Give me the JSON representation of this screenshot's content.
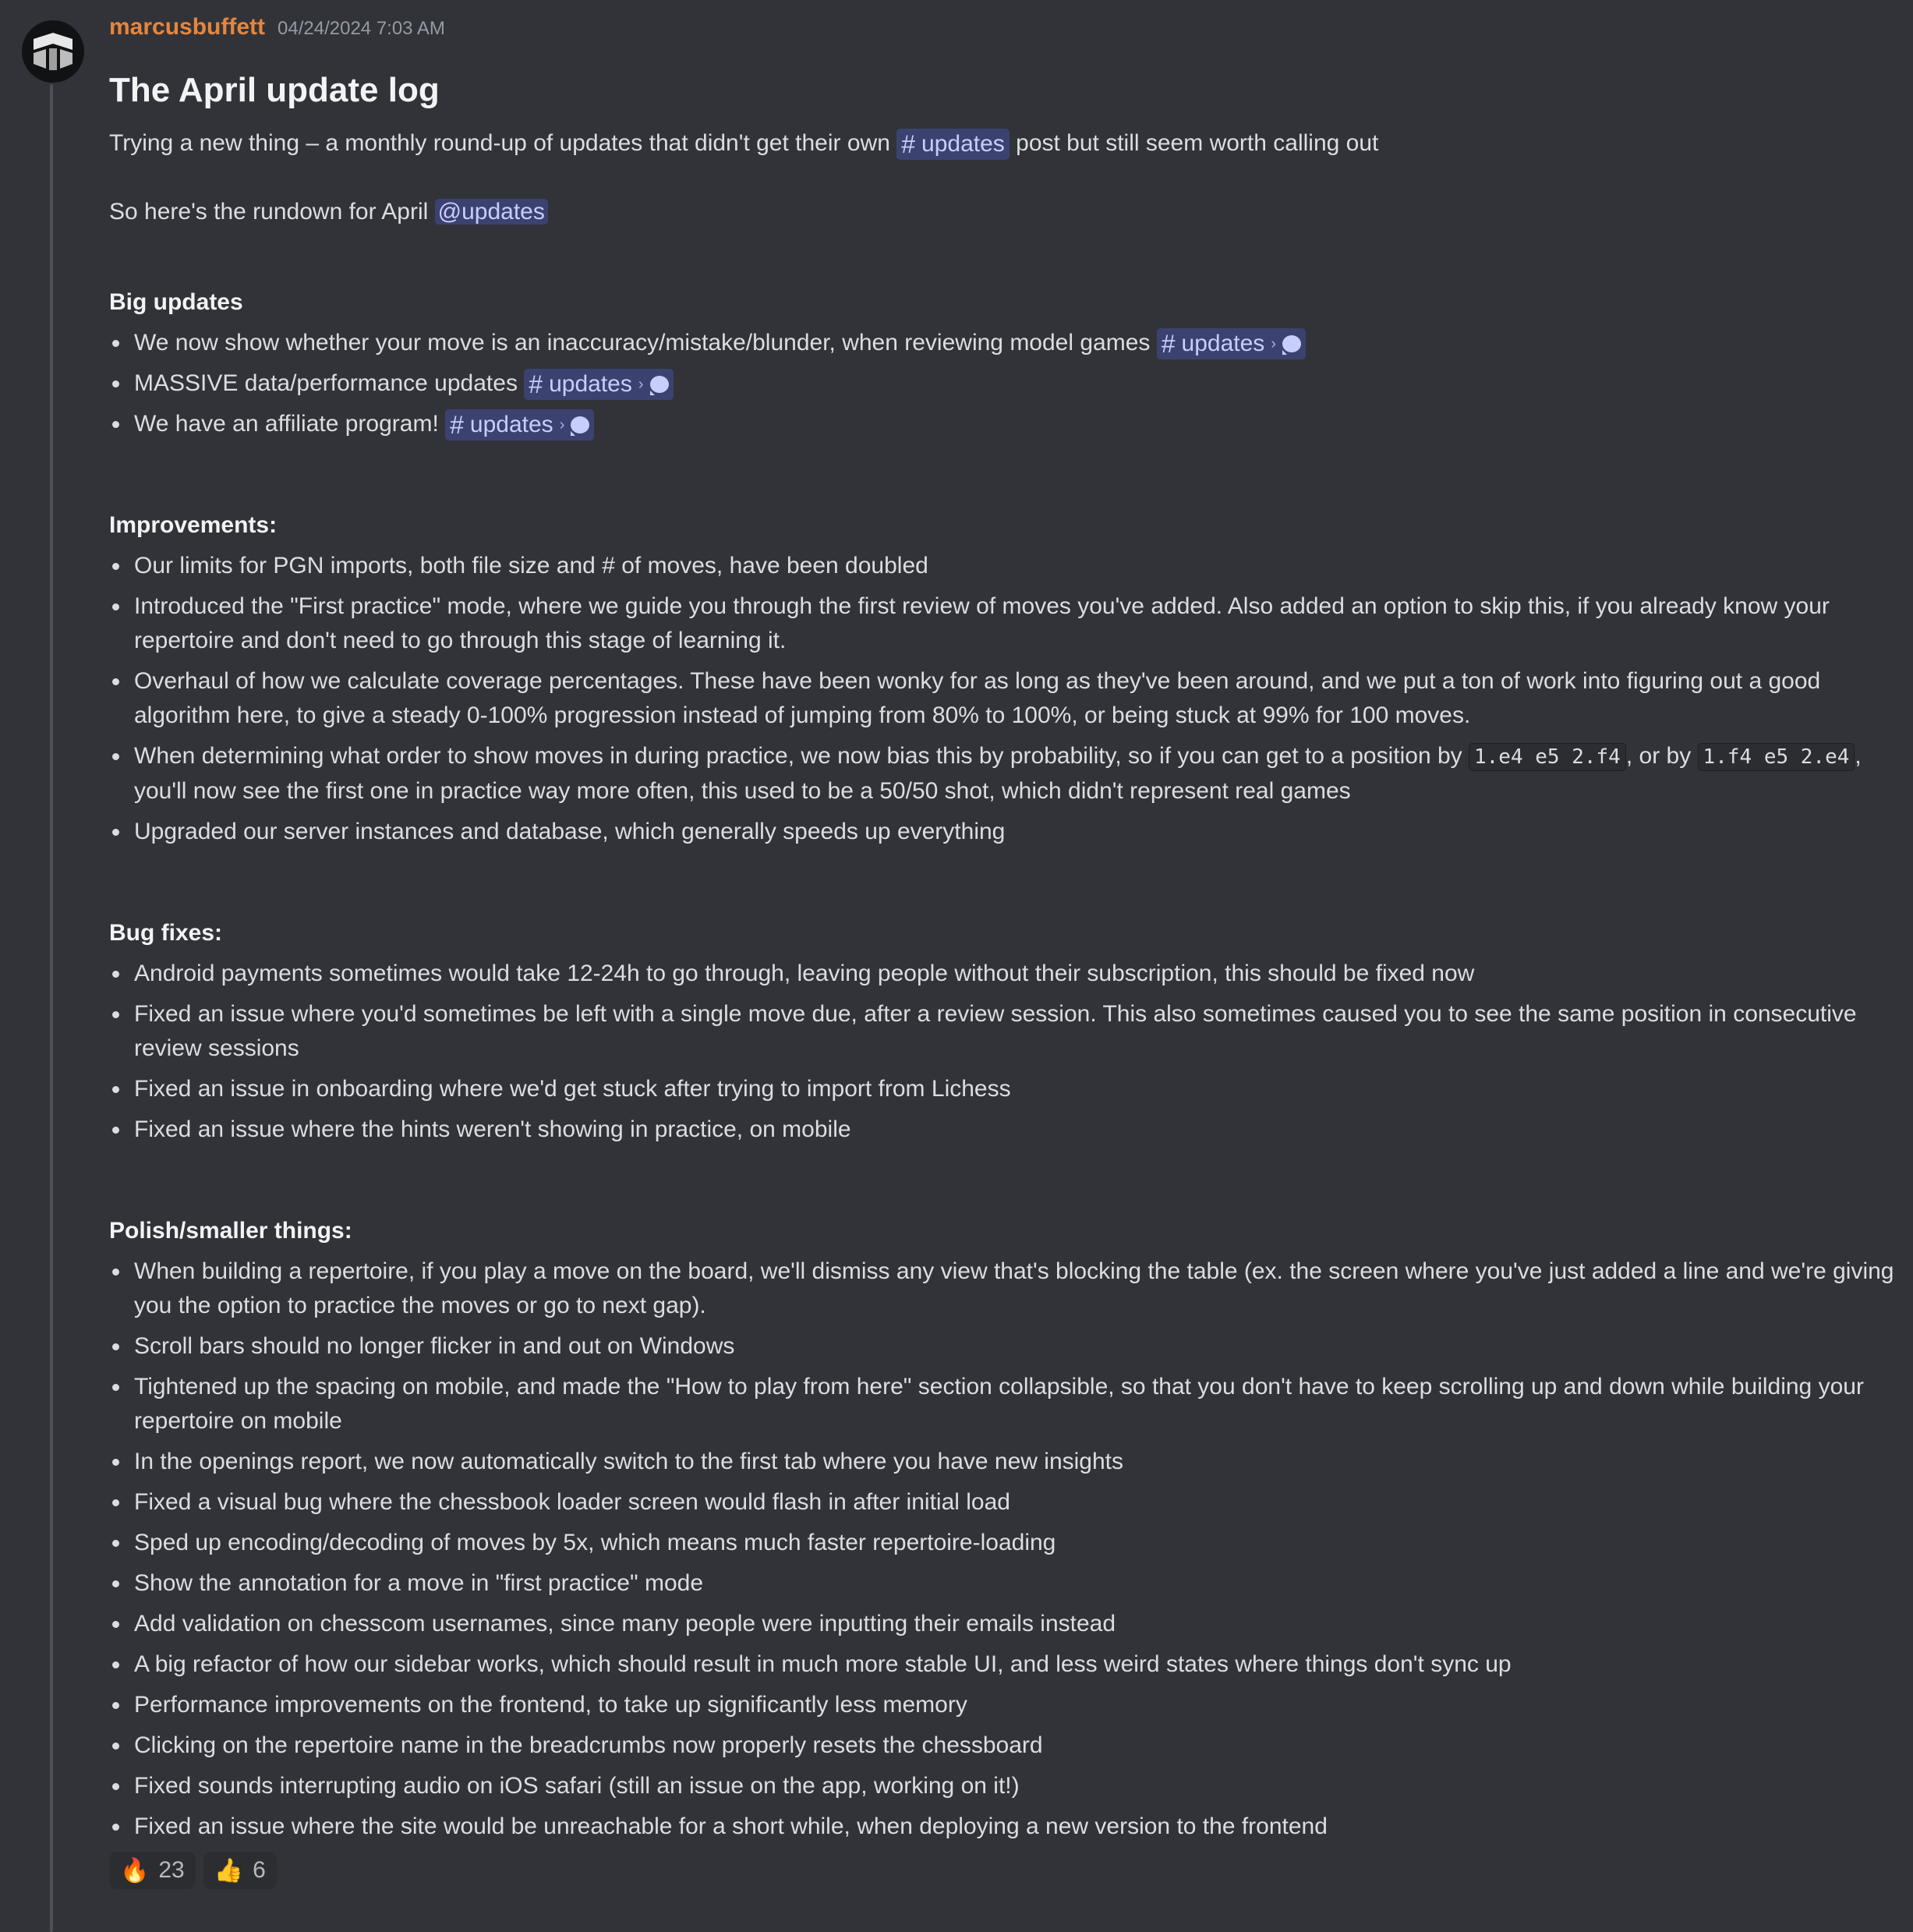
{
  "message": {
    "username": "marcusbuffett",
    "timestamp": "04/24/2024 7:03 AM",
    "title": "The April update log",
    "intro_before": "Trying a new thing – a monthly round-up of updates that didn't get their own ",
    "intro_channel": "updates",
    "intro_after": " post but still seem worth calling out",
    "rundown_text": "So here's the rundown for April ",
    "rundown_mention": "@updates"
  },
  "sections": {
    "big": {
      "heading": "Big updates",
      "items": [
        {
          "text": "We now show whether your move is an inaccuracy/mistake/blunder, when reviewing model games ",
          "channel": "updates"
        },
        {
          "text": "MASSIVE data/performance updates ",
          "channel": "updates"
        },
        {
          "text": "We have an affiliate program! ",
          "channel": "updates"
        }
      ]
    },
    "improvements": {
      "heading": "Improvements:",
      "items": [
        "Our limits for PGN imports, both file size and # of moves, have been doubled",
        "Introduced the \"First practice\" mode, where we guide you through the first review of moves you've added. Also added an option to skip this, if you already know your repertoire and don't need to go through this stage of learning it.",
        "Overhaul of how we calculate coverage percentages. These have been wonky for as long as they've been around, and we put a ton of work into figuring out a good algorithm here, to give a steady 0-100% progression instead of jumping from 80% to 100%, or being stuck at 99% for 100 moves.",
        "Upgraded our server instances and database, which generally speeds up everything"
      ],
      "probability_item": {
        "part1": "When determining what order to show moves in during practice, we now bias this by probability, so if you can get to a position by ",
        "code1": "1.e4 e5 2.f4",
        "part2": ", or by ",
        "code2": "1.f4 e5 2.e4",
        "part3": ", you'll now see the first one in practice way more often, this used to be a 50/50 shot, which didn't represent real games"
      }
    },
    "bugs": {
      "heading": "Bug fixes:",
      "items": [
        "Android payments sometimes would take 12-24h to go through, leaving people without their subscription, this should be fixed now",
        "Fixed an issue where you'd sometimes be left with a single move due, after a review session. This also sometimes caused you to see the same position in consecutive review sessions",
        "Fixed an issue in onboarding where we'd get stuck after trying to import from Lichess",
        "Fixed an issue where the hints weren't showing in practice, on mobile"
      ]
    },
    "polish": {
      "heading": "Polish/smaller things:",
      "items": [
        "When building a repertoire, if you play a move on the board, we'll dismiss any view that's blocking the table (ex. the screen where you've just added a line and we're giving you the option to practice the moves or go to next gap).",
        "Scroll bars should no longer flicker in and out on Windows",
        "Tightened up the spacing on mobile, and made the \"How to play from here\" section collapsible, so that you don't have to keep scrolling up and down while building your repertoire on mobile",
        "In the openings report, we now automatically switch to the first tab where you have new insights",
        "Fixed a visual bug where the chessbook loader screen would flash in after initial load",
        "Sped up encoding/decoding of moves by 5x, which means much faster repertoire-loading",
        "Show the annotation for a move in \"first practice\" mode",
        "Add validation on chesscom usernames, since many people were inputting their emails instead",
        "A big refactor of how our sidebar works, which should result in much more stable UI, and less weird states where things don't sync up",
        "Performance improvements on the frontend, to take up significantly less memory",
        "Clicking on the repertoire name in the breadcrumbs now properly resets the chessboard",
        "Fixed sounds interrupting audio on iOS safari (still an issue on the app, working on it!)",
        "Fixed an issue where the site would be unreachable for a short while, when deploying a new version to the frontend"
      ]
    }
  },
  "reactions": [
    {
      "emoji": "🔥",
      "icon": "fire-icon",
      "count": "23"
    },
    {
      "emoji": "👍",
      "icon": "thumbs-up-icon",
      "count": "6"
    }
  ],
  "icons": {
    "avatar": "chessbook-logo",
    "channel": "hash-icon",
    "thread": "chat-bubble-icon"
  },
  "colors": {
    "background": "#313338",
    "username": "#e8853d",
    "mention_bg": "#3c4270",
    "mention_fg": "#c9cdfb"
  }
}
